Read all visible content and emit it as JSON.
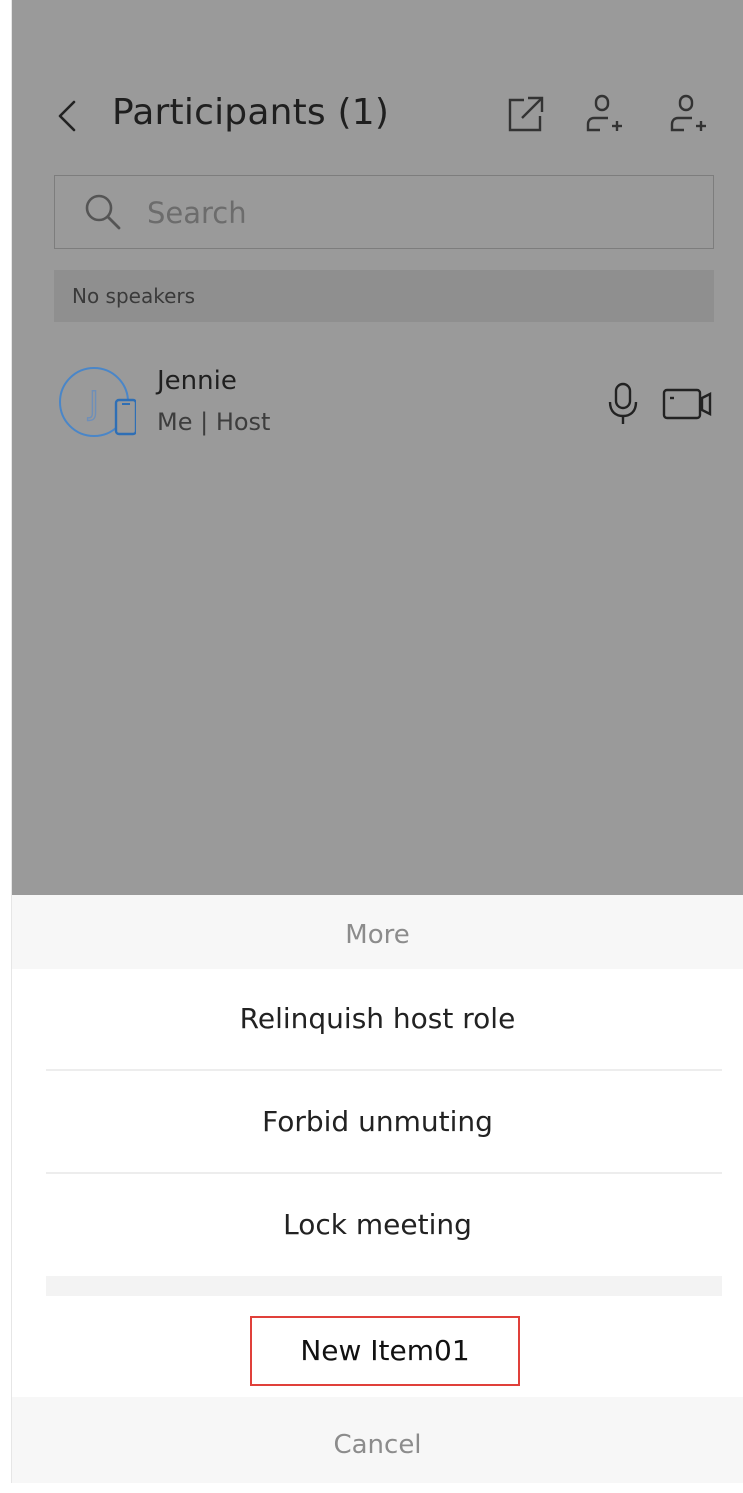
{
  "header": {
    "title": "Participants (1)",
    "back_icon": "chevron-left-icon",
    "share_icon": "share-external-icon",
    "invite_icon": "add-person-icon",
    "invite2_icon": "add-person-icon"
  },
  "search": {
    "placeholder": "Search",
    "icon": "search-icon"
  },
  "speakers": {
    "label": "No speakers"
  },
  "participants": [
    {
      "initial": "J",
      "name": "Jennie",
      "role": "Me | Host",
      "device_icon": "mobile-phone-icon",
      "mic_icon": "microphone-icon",
      "camera_icon": "video-camera-icon"
    }
  ],
  "sheet": {
    "title": "More",
    "items": [
      {
        "label": "Relinquish host role"
      },
      {
        "label": "Forbid unmuting"
      },
      {
        "label": "Lock meeting"
      }
    ],
    "new_item": "New Item01",
    "cancel": "Cancel"
  },
  "colors": {
    "overlay": "#9a9a9a",
    "avatar_blue": "#4a86c8",
    "highlight_border": "#e0403a"
  }
}
